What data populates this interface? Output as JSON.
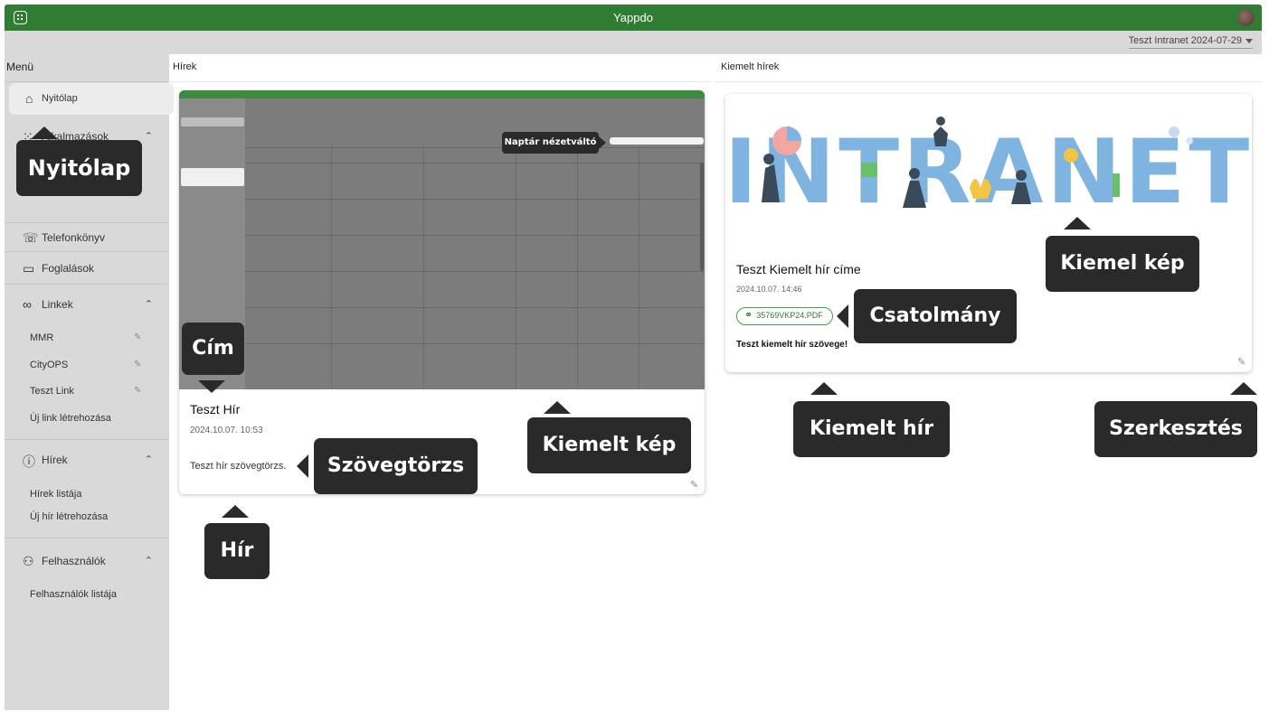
{
  "header": {
    "app_title": "Yappdo",
    "tenant": "Teszt Intranet 2024-07-29"
  },
  "sidebar": {
    "title": "Menü",
    "home": "Nyitólap",
    "apps": "Alkalmazások",
    "phonebook": "Telefonkönyv",
    "bookings": "Foglalások",
    "links": "Linkek",
    "link_items": [
      "MMR",
      "CityOPS",
      "Teszt Link"
    ],
    "new_link": "Új link létrehozása",
    "news": "Hírek",
    "news_list": "Hírek listája",
    "new_news": "Új hír létrehozása",
    "users": "Felhasználók",
    "users_list": "Felhasználók listája"
  },
  "news_section": {
    "title": "Hírek",
    "card": {
      "title": "Teszt Hír",
      "date": "2024.10.07. 10:53",
      "body": "Teszt hír szövegtörzs."
    }
  },
  "featured_section": {
    "title": "Kiemelt hírek",
    "card": {
      "image_text": "INTRANET",
      "title": "Teszt Kiemelt hír címe",
      "date": "2024.10.07. 14:46",
      "attachment": "35769VKP24.PDF",
      "body": "Teszt kiemelt hír szövege!"
    }
  },
  "callouts": {
    "nyitolap": "Nyitólap",
    "cim": "Cím",
    "naptar": "Naptár nézetváltó",
    "szovegtorzs": "Szövegtörzs",
    "kiemelt_kep": "Kiemelt kép",
    "hir": "Hír",
    "kiemel_kep": "Kiemel kép",
    "csatolmany": "Csatolmány",
    "kiemelt_hir": "Kiemelt hír",
    "szerkesztes": "Szerkesztés"
  },
  "colors": {
    "brand": "#2e7d32",
    "callout_bg": "#2a2a2a",
    "sidebar_bg": "#d9d9d9",
    "intranet_blue": "#7fb3e0"
  }
}
